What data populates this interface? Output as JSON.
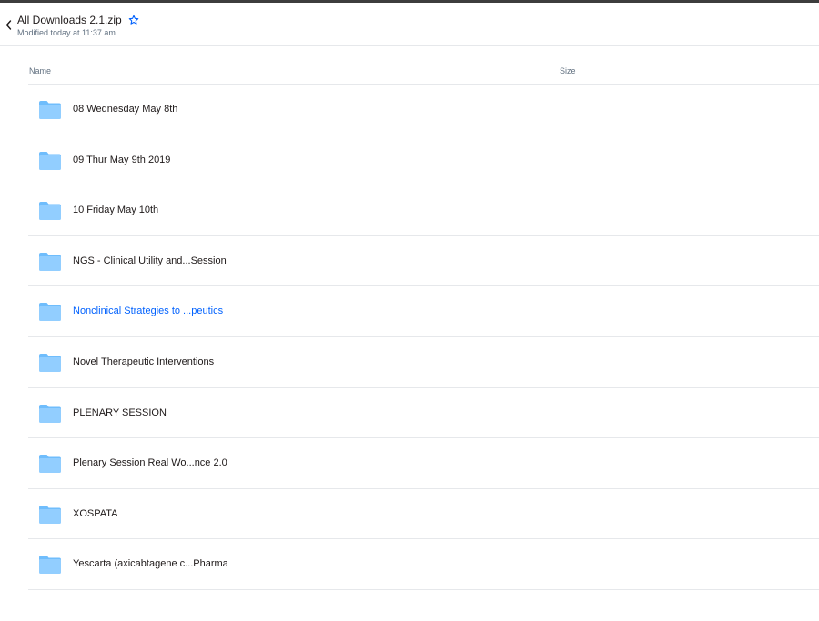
{
  "header": {
    "title": "All Downloads 2.1.zip",
    "subtitle": "Modified today at 11:37 am",
    "back_icon": "chevron-left-icon",
    "star_icon": "star-outline-icon"
  },
  "colors": {
    "accent": "#0061fe",
    "folder": "#92ceff",
    "folder_tab": "#6fbdfc",
    "divider": "#e6e8eb",
    "muted_text": "#637282"
  },
  "columns": {
    "name": "Name",
    "size": "Size"
  },
  "items": [
    {
      "name": "08 Wednesday May 8th",
      "size": "",
      "icon": "folder-icon"
    },
    {
      "name": "09 Thur May 9th 2019",
      "size": "",
      "icon": "folder-icon"
    },
    {
      "name": "10 Friday May 10th",
      "size": "",
      "icon": "folder-icon"
    },
    {
      "name": "NGS - Clinical Utility and...Session",
      "size": "",
      "icon": "folder-icon"
    },
    {
      "name": "Nonclinical Strategies to ...peutics",
      "size": "",
      "icon": "folder-icon",
      "hover": true
    },
    {
      "name": "Novel Therapeutic Interventions",
      "size": "",
      "icon": "folder-icon"
    },
    {
      "name": "PLENARY SESSION",
      "size": "",
      "icon": "folder-icon"
    },
    {
      "name": "Plenary Session Real Wo...nce 2.0",
      "size": "",
      "icon": "folder-icon"
    },
    {
      "name": "XOSPATA",
      "size": "",
      "icon": "folder-icon"
    },
    {
      "name": "Yescarta (axicabtagene c...Pharma",
      "size": "",
      "icon": "folder-icon"
    }
  ]
}
